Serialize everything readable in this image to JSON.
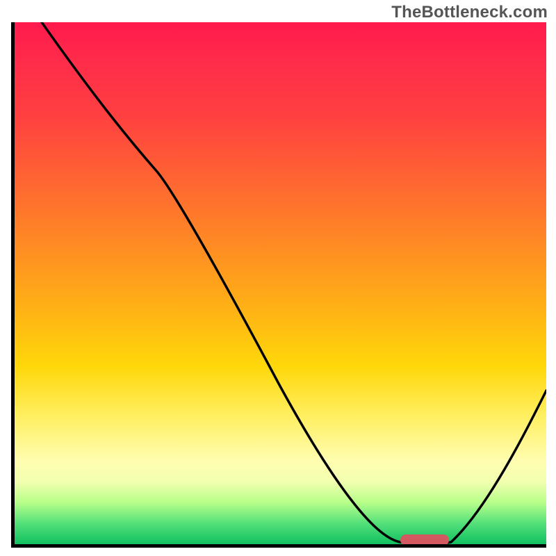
{
  "watermark": "TheBottleneck.com",
  "chart_data": {
    "type": "line",
    "title": "",
    "xlabel": "",
    "ylabel": "",
    "xlim": [
      0,
      1
    ],
    "ylim": [
      0,
      1
    ],
    "grid": false,
    "legend": false,
    "background": {
      "kind": "vertical-gradient",
      "stops": [
        {
          "pos": 0.0,
          "color": "#ff1a4d"
        },
        {
          "pos": 0.18,
          "color": "#ff4040"
        },
        {
          "pos": 0.44,
          "color": "#ff8f22"
        },
        {
          "pos": 0.66,
          "color": "#ffd80a"
        },
        {
          "pos": 0.84,
          "color": "#fffdb0"
        },
        {
          "pos": 0.92,
          "color": "#b8ff8a"
        },
        {
          "pos": 1.0,
          "color": "#10c060"
        }
      ],
      "meaning": "color encodes distance from optimal; green=good near bottom, red=bad near top"
    },
    "series": [
      {
        "name": "bottleneck-curve",
        "color": "#000000",
        "x": [
          0.05,
          0.15,
          0.22,
          0.27,
          0.35,
          0.45,
          0.55,
          0.65,
          0.73,
          0.78,
          0.82,
          0.9,
          1.0
        ],
        "y": [
          1.0,
          0.85,
          0.76,
          0.71,
          0.56,
          0.38,
          0.2,
          0.07,
          0.005,
          0.0,
          0.005,
          0.13,
          0.3
        ],
        "note": "y is normalized height above the x-axis (0 at axis, 1 at top). No numeric tick labels are shown in the source image; values are read proportionally."
      }
    ],
    "markers": [
      {
        "name": "optimal-range",
        "shape": "pill",
        "color": "#d1595f",
        "x_start": 0.725,
        "x_end": 0.815,
        "y": 0.01
      }
    ]
  }
}
